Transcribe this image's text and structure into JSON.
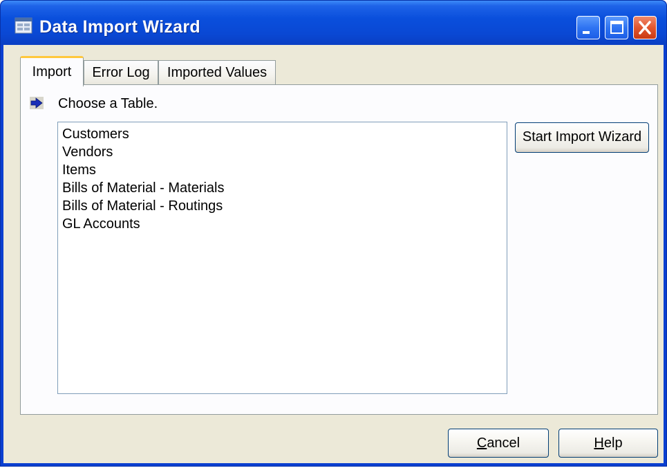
{
  "window": {
    "title": "Data Import Wizard",
    "title_icon": "wizard-form-icon",
    "controls": [
      "minimize-icon",
      "maximize-icon",
      "close-icon"
    ]
  },
  "tabs": [
    {
      "label": "Import",
      "active": true
    },
    {
      "label": "Error Log",
      "active": false
    },
    {
      "label": "Imported Values",
      "active": false
    }
  ],
  "import_tab": {
    "instruction_icon": "arrow-right-icon",
    "instruction": "Choose a Table.",
    "tables": [
      "Customers",
      "Vendors",
      "Items",
      "Bills of Material - Materials",
      "Bills of Material - Routings",
      "GL Accounts"
    ],
    "start_button": "Start Import Wizard"
  },
  "footer": {
    "cancel_first": "C",
    "cancel_rest": "ancel",
    "help_first": "H",
    "help_rest": "elp"
  },
  "colors": {
    "titlebar": "#0a4fdc",
    "client": "#ece9d8",
    "active_tab_accent": "#ffc83c",
    "close_button": "#e2562e"
  }
}
